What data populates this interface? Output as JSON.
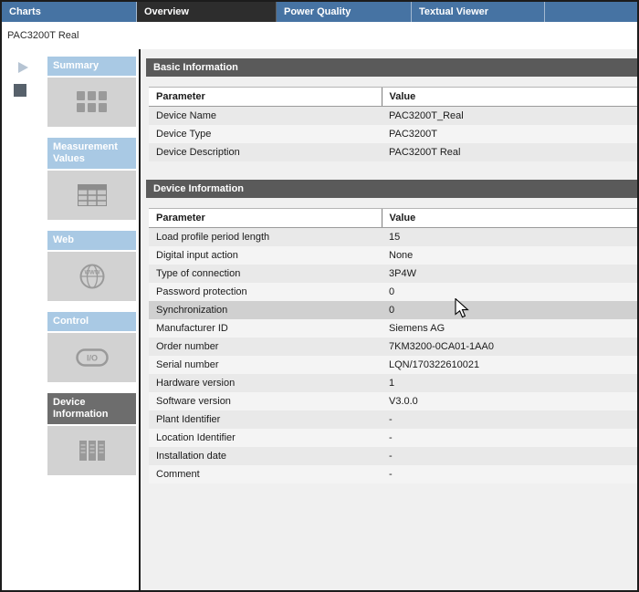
{
  "tabs": [
    {
      "label": "Charts",
      "selected": false
    },
    {
      "label": "Overview",
      "selected": true
    },
    {
      "label": "Power Quality",
      "selected": false
    },
    {
      "label": "Textual Viewer",
      "selected": false
    }
  ],
  "device_title": "PAC3200T Real",
  "left_toolbar": {
    "icons": [
      "play-icon",
      "stop-icon"
    ]
  },
  "sidebar": {
    "items": [
      {
        "label": "Summary",
        "icon": "summary-grid-icon",
        "selected": false
      },
      {
        "label": "Measurement Values",
        "icon": "measurement-table-icon",
        "selected": false
      },
      {
        "label": "Web",
        "icon": "web-globe-icon",
        "icon_label": "WWW",
        "selected": false
      },
      {
        "label": "Control",
        "icon": "control-io-icon",
        "icon_label": "I/O",
        "selected": false
      },
      {
        "label": "Device Information",
        "icon": "device-info-book-icon",
        "selected": true
      }
    ]
  },
  "sections": {
    "basic_information": {
      "title": "Basic Information",
      "columns": [
        "Parameter",
        "Value"
      ],
      "rows": [
        [
          "Device Name",
          "PAC3200T_Real"
        ],
        [
          "Device Type",
          "PAC3200T"
        ],
        [
          "Device Description",
          "PAC3200T Real"
        ]
      ]
    },
    "device_information": {
      "title": "Device Information",
      "columns": [
        "Parameter",
        "Value"
      ],
      "highlighted_row": 4,
      "rows": [
        [
          "Load profile period length",
          "15"
        ],
        [
          "Digital input action",
          "None"
        ],
        [
          "Type of connection",
          "3P4W"
        ],
        [
          "Password protection",
          "0"
        ],
        [
          "Synchronization",
          "0"
        ],
        [
          "Manufacturer ID",
          "Siemens AG"
        ],
        [
          "Order number",
          "7KM3200-0CA01-1AA0"
        ],
        [
          "Serial number",
          "LQN/170322610021"
        ],
        [
          "Hardware version",
          "1"
        ],
        [
          "Software version",
          "V3.0.0"
        ],
        [
          "Plant Identifier",
          "-"
        ],
        [
          "Location Identifier",
          "-"
        ],
        [
          "Installation date",
          "-"
        ],
        [
          "Comment",
          "-"
        ]
      ]
    }
  },
  "colors": {
    "tab_bar": "#4673a3",
    "tab_selected": "#2d2d2d",
    "sidebar_header": "#a9c9e4",
    "sidebar_selected": "#6d6d6d",
    "section_header": "#5a5a5a",
    "row_alt": "#e9e9e9",
    "row_highlight": "#d0d0d0"
  }
}
